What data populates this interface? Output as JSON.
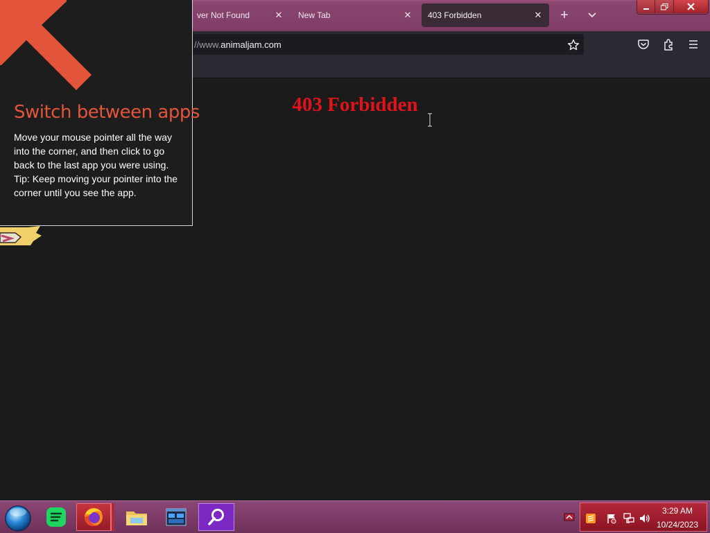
{
  "browser": {
    "tabs": [
      {
        "title": "ver Not Found",
        "close": "✕"
      },
      {
        "title": "New Tab",
        "close": "✕"
      },
      {
        "title": "403 Forbidden",
        "close": "✕",
        "active": true
      }
    ],
    "new_tab_symbol": "+",
    "url": {
      "prefix": "//www.",
      "host": "animaljam.com"
    }
  },
  "page": {
    "heading": "403 Forbidden",
    "heading_color": "#e0121a"
  },
  "tip": {
    "title": "Switch between apps",
    "body": "Move your mouse pointer all the way into the corner, and then click to go back to the last app you were using.",
    "tip_line": "Tip: Keep moving your pointer into the corner until you see the app.",
    "accent_color": "#e2553a"
  },
  "taskbar": {
    "pinned": [
      "start-orb-icon",
      "spotify-icon",
      "firefox-icon",
      "file-explorer-icon",
      "task-manager-icon",
      "search-app-icon"
    ],
    "clock": {
      "time": "3:29 AM",
      "date": "10/24/2023"
    },
    "tray_icons": [
      "sublime-text-icon",
      "action-center-flag-icon",
      "network-icon",
      "volume-icon"
    ]
  },
  "icons": {
    "caption": [
      "minimize-icon",
      "restore-icon",
      "close-icon"
    ],
    "navbar": [
      "bookmark-star-icon",
      "pocket-icon",
      "extensions-icon",
      "menu-icon"
    ]
  }
}
